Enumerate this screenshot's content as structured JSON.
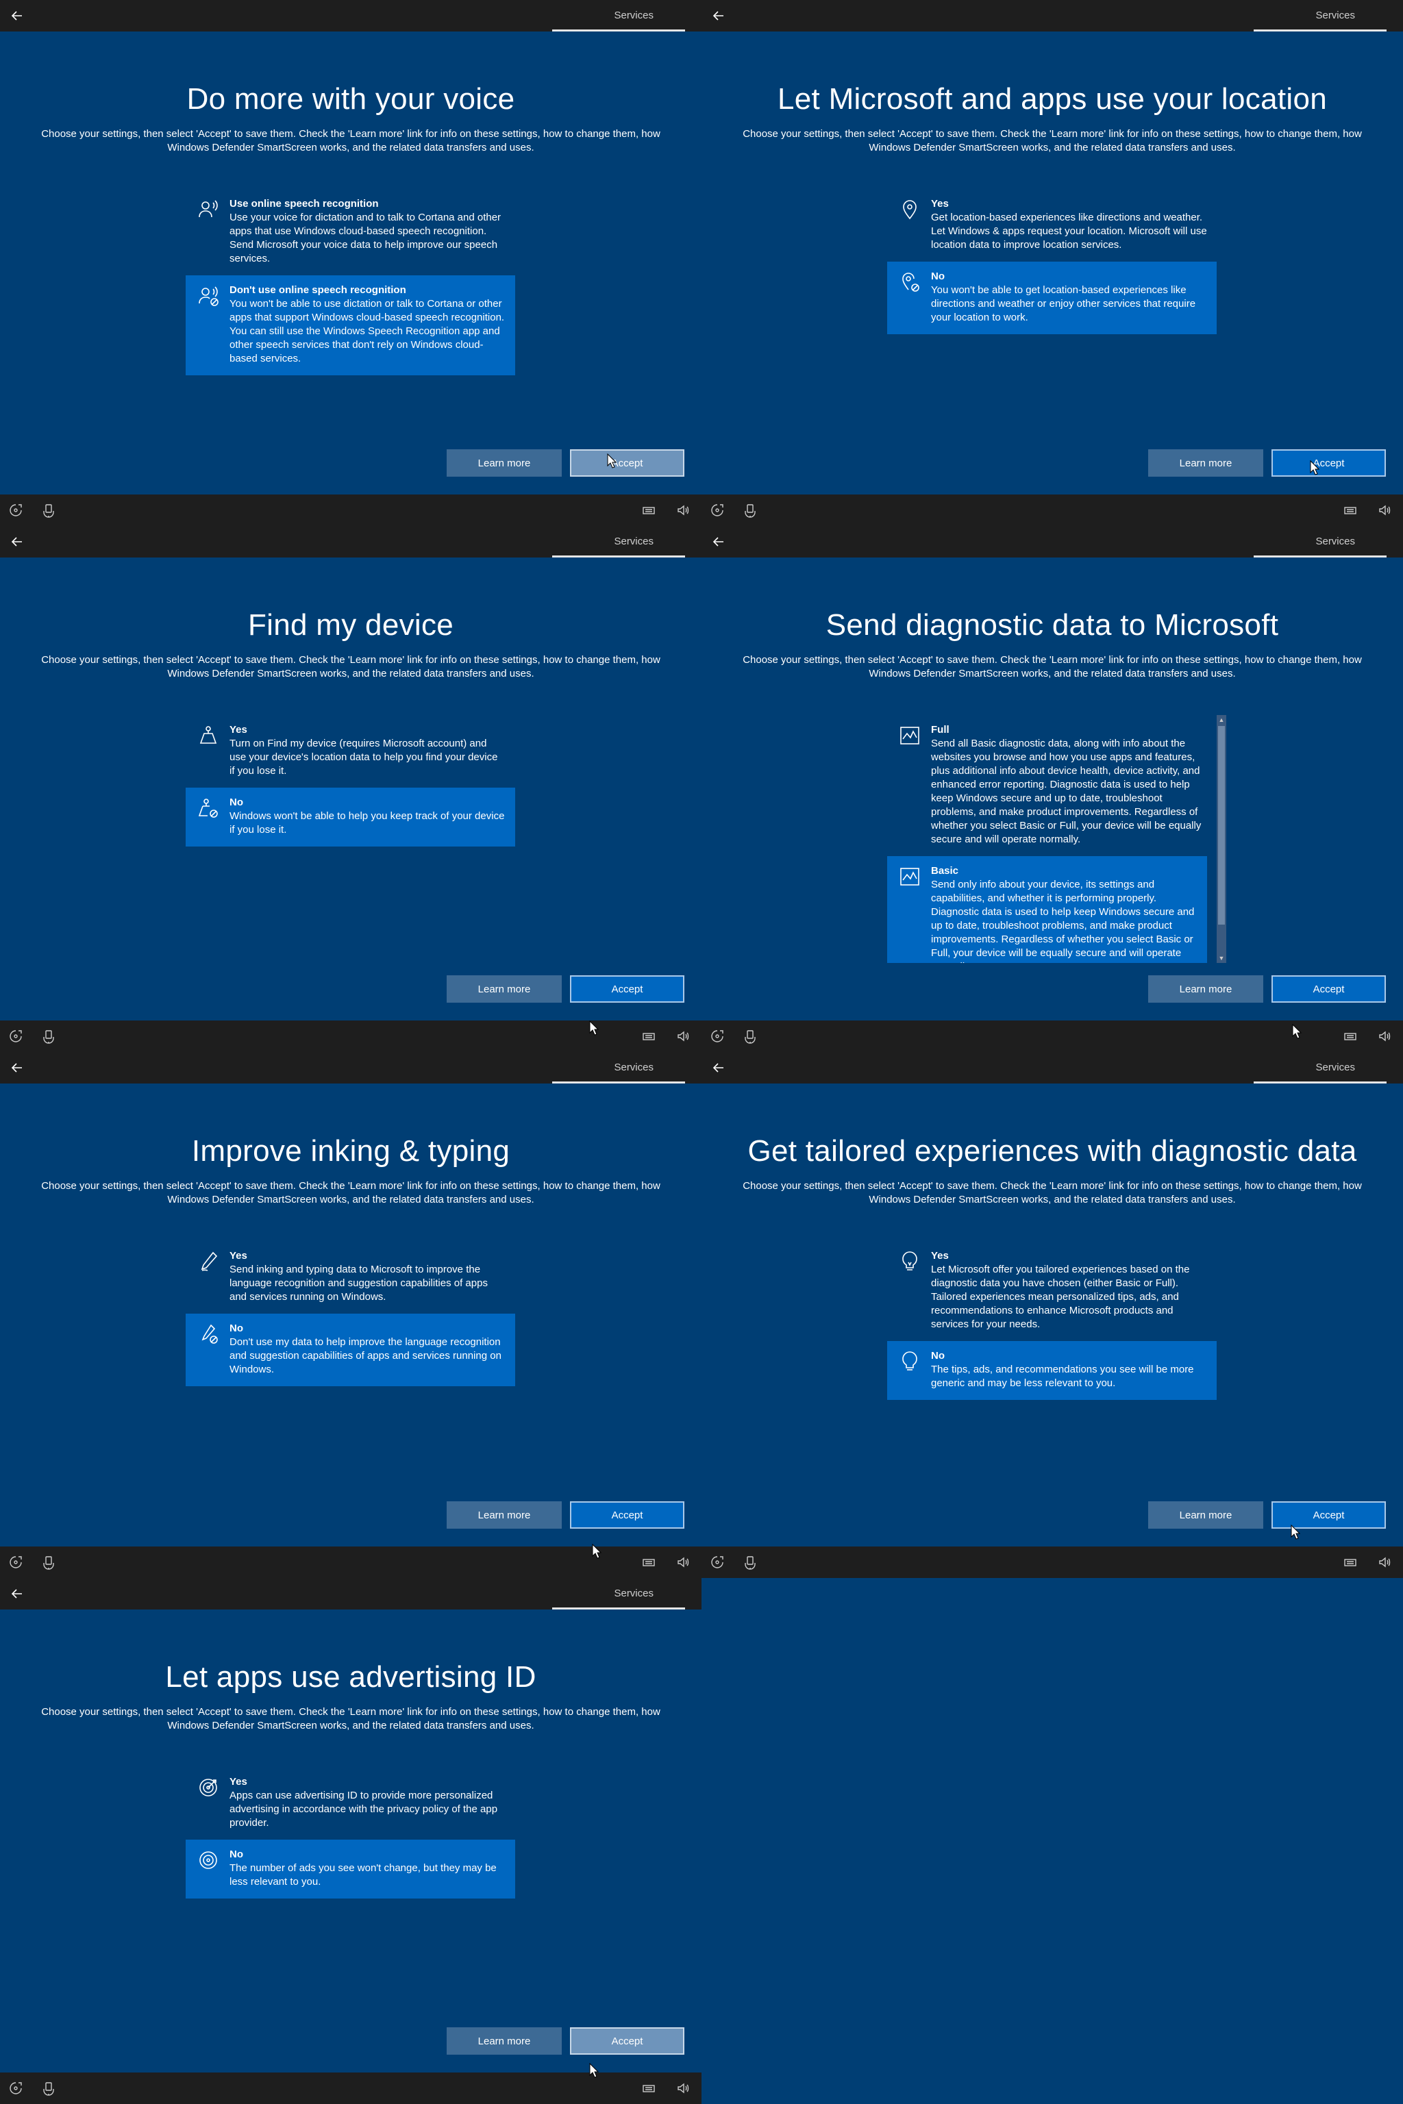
{
  "common": {
    "tab_label": "Services",
    "back_label": "Back",
    "description": "Choose your settings, then select 'Accept' to save them. Check the 'Learn more' link for info on these settings, how to change them, how Windows Defender SmartScreen works, and the related data transfers and uses.",
    "learn_more_label": "Learn more",
    "accept_label": "Accept"
  },
  "colors": {
    "background": "#003e74",
    "bar": "#1e1e1e",
    "selected_option": "#0067c0",
    "learn_more_button": "#3d6a95",
    "accept_button": "#0067c0"
  },
  "panels": [
    {
      "title": "Do more with your voice",
      "options": [
        {
          "icon": "speech-icon",
          "heading": "Use online speech recognition",
          "body": "Use your voice for dictation and to talk to Cortana and other apps that use Windows cloud-based speech recognition. Send Microsoft your voice data to help improve our speech services.",
          "selected": false
        },
        {
          "icon": "speech-off-icon",
          "heading": "Don't use online speech recognition",
          "body": "You won't be able to use dictation or talk to Cortana or other apps that support Windows cloud-based speech recognition. You can still use the Windows Speech Recognition app and other speech services that don't rely on Windows cloud-based services.",
          "selected": true
        }
      ]
    },
    {
      "title": "Let Microsoft and apps use your location",
      "options": [
        {
          "icon": "location-pin-icon",
          "heading": "Yes",
          "body": "Get location-based experiences like directions and weather. Let Windows & apps request your location. Microsoft will use location data to improve location services.",
          "selected": false
        },
        {
          "icon": "location-off-icon",
          "heading": "No",
          "body": "You won't be able to get location-based experiences like directions and weather or enjoy other services that require your location to work.",
          "selected": true
        }
      ]
    },
    {
      "title": "Find my device",
      "options": [
        {
          "icon": "find-device-icon",
          "heading": "Yes",
          "body": "Turn on Find my device (requires Microsoft account) and use your device's location data to help you find your device if you lose it.",
          "selected": false
        },
        {
          "icon": "find-device-off-icon",
          "heading": "No",
          "body": "Windows won't be able to help you keep track of your device if you lose it.",
          "selected": true
        }
      ]
    },
    {
      "title": "Send diagnostic data to Microsoft",
      "options": [
        {
          "icon": "diagnostic-chart-icon",
          "heading": "Full",
          "body": "Send all Basic diagnostic data, along with info about the websites you browse and how you use apps and features, plus additional info about device health, device activity, and enhanced error reporting. Diagnostic data is used to help keep Windows secure and up to date, troubleshoot problems, and make product improvements. Regardless of whether you select Basic or Full, your device will be equally secure and will operate normally.",
          "selected": false
        },
        {
          "icon": "diagnostic-chart-icon",
          "heading": "Basic",
          "body": "Send only info about your device, its settings and capabilities, and whether it is performing properly. Diagnostic data is used to help keep Windows secure and up to date, troubleshoot problems, and make product improvements. Regardless of whether you select Basic or Full, your device will be equally secure and will operate normally.",
          "selected": true
        }
      ]
    },
    {
      "title": "Improve inking & typing",
      "options": [
        {
          "icon": "pen-icon",
          "heading": "Yes",
          "body": "Send inking and typing data to Microsoft to improve the language recognition and suggestion capabilities of apps and services running on Windows.",
          "selected": false
        },
        {
          "icon": "pen-off-icon",
          "heading": "No",
          "body": "Don't use my data to help improve the language recognition and suggestion capabilities of apps and services running on Windows.",
          "selected": true
        }
      ]
    },
    {
      "title": "Get tailored experiences with diagnostic data",
      "options": [
        {
          "icon": "lightbulb-icon",
          "heading": "Yes",
          "body": "Let Microsoft offer you tailored experiences based on the diagnostic data you have chosen (either Basic or Full). Tailored experiences mean personalized tips, ads, and recommendations to enhance Microsoft products and services for your needs.",
          "selected": false
        },
        {
          "icon": "lightbulb-off-icon",
          "heading": "No",
          "body": "The tips, ads, and recommendations you see will be more generic and may be less relevant to you.",
          "selected": true
        }
      ]
    },
    {
      "title": "Let apps use advertising ID",
      "options": [
        {
          "icon": "target-icon",
          "heading": "Yes",
          "body": "Apps can use advertising ID to provide more personalized advertising in accordance with the privacy policy of the app provider.",
          "selected": false
        },
        {
          "icon": "target-off-icon",
          "heading": "No",
          "body": "The number of ads you see won't change, but they may be less relevant to you.",
          "selected": true
        }
      ]
    }
  ]
}
